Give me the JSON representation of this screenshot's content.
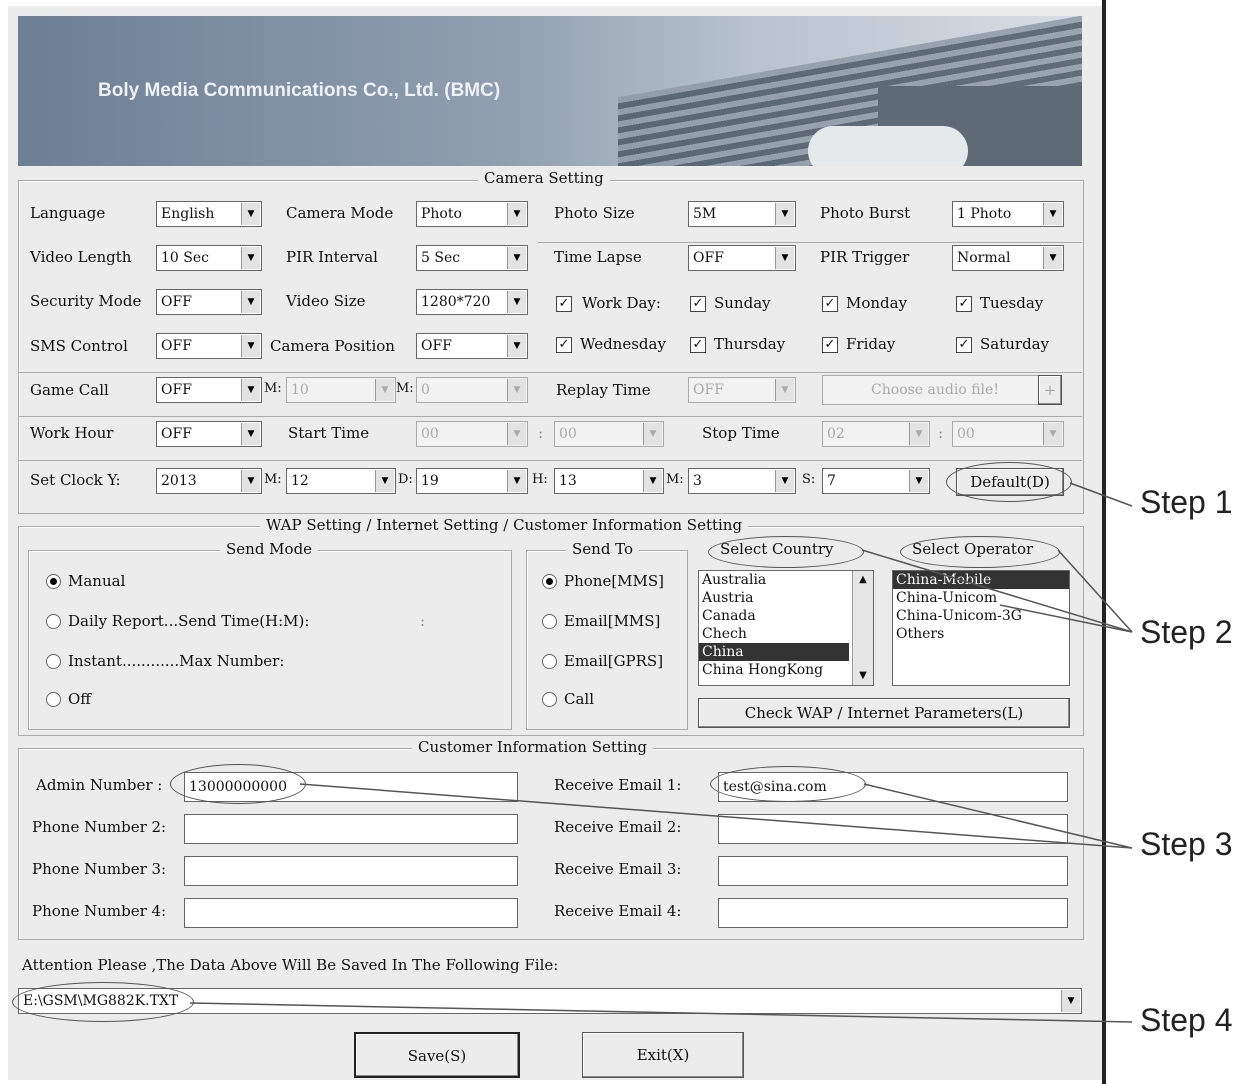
{
  "banner": {
    "company": "Boly Media Communications Co., Ltd. (BMC)"
  },
  "camera_setting": {
    "legend": "Camera Setting",
    "language": {
      "label": "Language",
      "value": "English"
    },
    "camera_mode": {
      "label": "Camera Mode",
      "value": "Photo"
    },
    "photo_size": {
      "label": "Photo Size",
      "value": "5M"
    },
    "photo_burst": {
      "label": "Photo Burst",
      "value": "1 Photo"
    },
    "video_length": {
      "label": "Video Length",
      "value": "10  Sec"
    },
    "pir_interval": {
      "label": "PIR Interval",
      "value": "5  Sec"
    },
    "time_lapse": {
      "label": "Time Lapse",
      "value": "OFF"
    },
    "pir_trigger": {
      "label": "PIR Trigger",
      "value": "Normal"
    },
    "security_mode": {
      "label": "Security Mode",
      "value": "OFF"
    },
    "video_size": {
      "label": "Video Size",
      "value": "1280*720"
    },
    "work_day": {
      "label": "Work Day:",
      "checked": true
    },
    "days": [
      {
        "label": "Sunday",
        "checked": true
      },
      {
        "label": "Monday",
        "checked": true
      },
      {
        "label": "Tuesday",
        "checked": true
      },
      {
        "label": "Wednesday",
        "checked": true
      },
      {
        "label": "Thursday",
        "checked": true
      },
      {
        "label": "Friday",
        "checked": true
      },
      {
        "label": "Saturday",
        "checked": true
      }
    ],
    "sms_control": {
      "label": "SMS Control",
      "value": "OFF"
    },
    "camera_position": {
      "label": "Camera Position",
      "value": "OFF"
    },
    "game_call": {
      "label": "Game Call",
      "value": "OFF",
      "m_label": "M:",
      "m_value": "10",
      "n_label": "M:",
      "n_value": "0"
    },
    "replay_time": {
      "label": "Replay Time",
      "value": "OFF"
    },
    "choose_audio": {
      "label": "Choose audio file!",
      "plus": "+"
    },
    "work_hour": {
      "label": "Work Hour",
      "value": "OFF"
    },
    "start_time": {
      "label": "Start Time",
      "h": "00",
      "sep": ":",
      "m": "00"
    },
    "stop_time": {
      "label": "Stop Time",
      "h": "02",
      "sep": ":",
      "m": "00"
    },
    "set_clock": {
      "label": "Set Clock Y:",
      "y": "2013",
      "m_label": "M:",
      "m": "12",
      "d_label": "D:",
      "d": "19",
      "h_label": "H:",
      "h": "13",
      "mi_label": "M:",
      "mi": "3",
      "s_label": "S:",
      "s": "7"
    },
    "default_button": "Default(D)"
  },
  "wap": {
    "legend": "WAP Setting / Internet Setting / Customer Information Setting",
    "send_mode": {
      "legend": "Send Mode",
      "manual": "Manual",
      "daily": "Daily Report...Send Time(H:M):",
      "daily_sep": ":",
      "instant": "Instant............Max Number:",
      "off": "Off"
    },
    "send_to": {
      "legend": "Send To",
      "phone_mms": "Phone[MMS]",
      "email_mms": "Email[MMS]",
      "email_gprs": "Email[GPRS]",
      "call": "Call"
    },
    "select_country": {
      "legend": "Select Country",
      "items": [
        "Australia",
        "Austria",
        "Canada",
        "Chech",
        "China",
        "China HongKong"
      ],
      "selected": "China"
    },
    "select_operator": {
      "legend": "Select Operator",
      "items": [
        "China-Mobile",
        "China-Unicom",
        "China-Unicom-3G",
        "Others"
      ],
      "selected": "China-Mobile"
    },
    "check_button": "Check WAP / Internet Parameters(L)"
  },
  "customer": {
    "legend": "Customer Information Setting",
    "admin": {
      "label": "Admin Number :",
      "value": "13000000000"
    },
    "phone2": {
      "label": "Phone Number 2:",
      "value": ""
    },
    "phone3": {
      "label": "Phone Number 3:",
      "value": ""
    },
    "phone4": {
      "label": "Phone Number 4:",
      "value": ""
    },
    "email1": {
      "label": "Receive Email 1:",
      "value": "test@sina.com"
    },
    "email2": {
      "label": "Receive Email 2:",
      "value": ""
    },
    "email3": {
      "label": "Receive Email 3:",
      "value": ""
    },
    "email4": {
      "label": "Receive Email 4:",
      "value": ""
    }
  },
  "footer": {
    "attention": "Attention Please ,The Data Above Will Be Saved In The Following File:",
    "file_path": "E:\\GSM\\MG882K.TXT",
    "save": "Save(S)",
    "exit": "Exit(X)"
  },
  "steps": [
    "Step 1",
    "Step 2",
    "Step 3",
    "Step 4"
  ]
}
